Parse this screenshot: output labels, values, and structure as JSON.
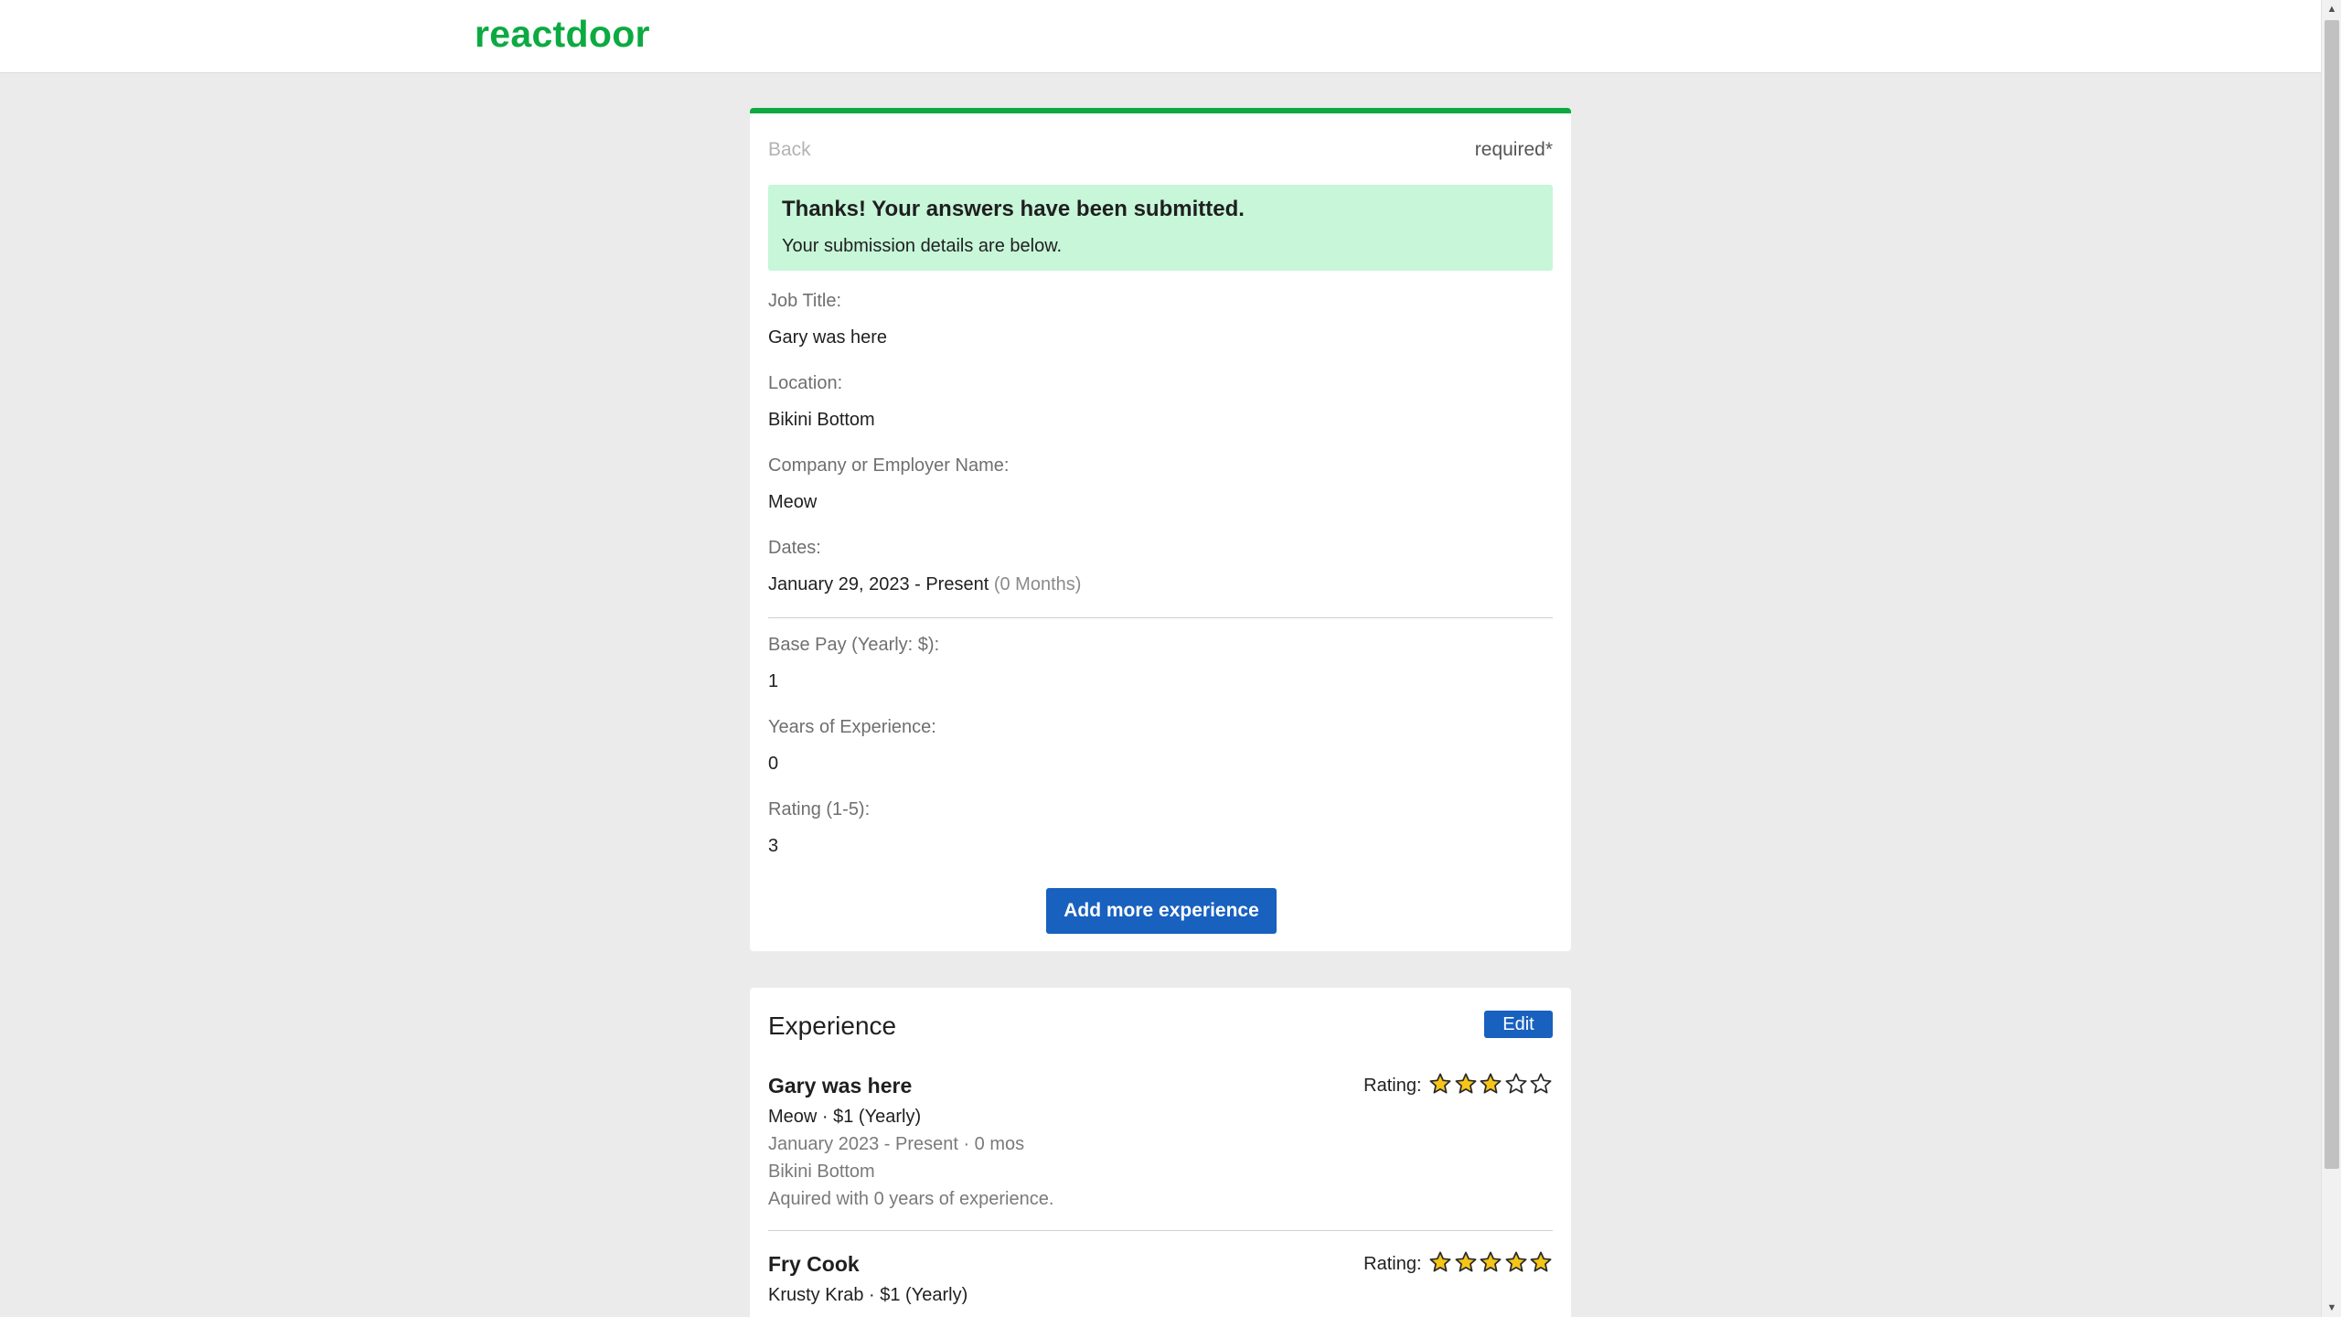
{
  "header": {
    "logo": "reactdoor"
  },
  "form": {
    "back_label": "Back",
    "required_note": "required*",
    "success": {
      "title": "Thanks! Your answers have been submitted.",
      "subtitle": "Your submission details are below."
    },
    "fields": [
      {
        "label": "Job Title:",
        "value": "Gary was here"
      },
      {
        "label": "Location:",
        "value": "Bikini Bottom"
      },
      {
        "label": "Company or Employer Name:",
        "value": "Meow"
      },
      {
        "label": "Dates:",
        "value": "January 29, 2023 - Present",
        "extra": "(0 Months)"
      },
      {
        "label": "Base Pay (Yearly: $):",
        "value": "1"
      },
      {
        "label": "Years of Experience:",
        "value": "0"
      },
      {
        "label": "Rating (1-5):",
        "value": "3"
      }
    ],
    "add_button_label": "Add more experience"
  },
  "experience": {
    "title": "Experience",
    "edit_label": "Edit",
    "rating_label": "Rating:",
    "items": [
      {
        "job_title": "Gary was here",
        "company_pay": "Meow · $1 (Yearly)",
        "dates": "January 2023 - Present · 0 mos",
        "location": "Bikini Bottom",
        "experience_note": "Aquired with 0 years of experience.",
        "rating": 3
      },
      {
        "job_title": "Fry Cook",
        "company_pay": "Krusty Krab · $1 (Yearly)",
        "rating": 5
      }
    ]
  },
  "colors": {
    "brand": "#0caa41",
    "primary_button": "#1861bf",
    "success_bg": "#c7f6d9",
    "star_fill": "#f5c518"
  },
  "icons": {
    "star_filled": "star-icon",
    "star_empty": "star-outline-icon"
  }
}
